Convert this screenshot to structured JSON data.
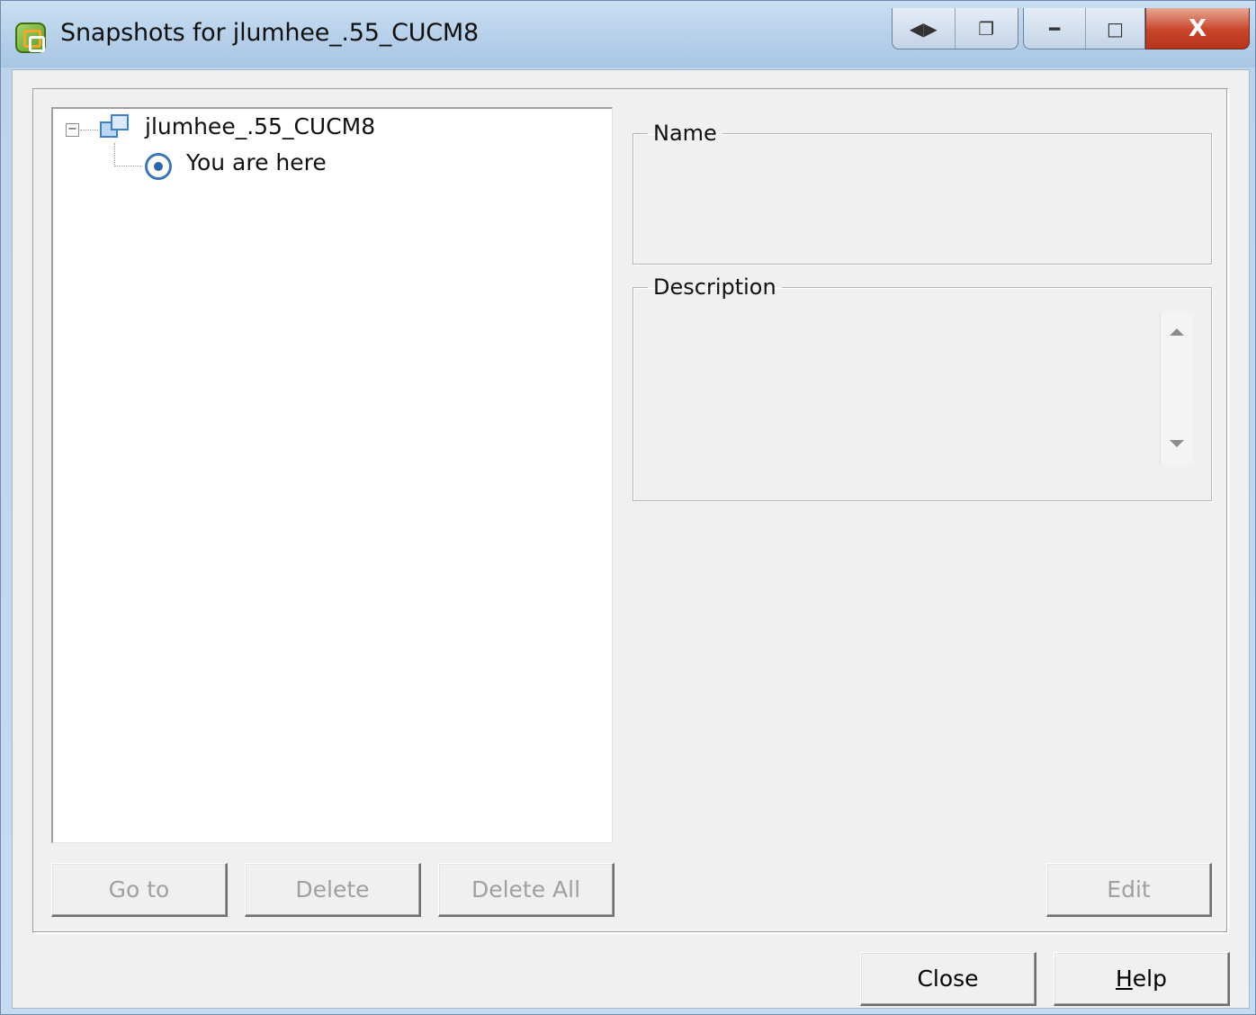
{
  "window": {
    "title": "Snapshots for jlumhee_.55_CUCM8",
    "caption_buttons": [
      "view-toggle-icon",
      "copy-icon",
      "minimize-icon",
      "maximize-icon",
      "close-icon"
    ],
    "close_glyph": "X"
  },
  "tree": {
    "root_label": "jlumhee_.55_CUCM8",
    "child_label": "You are here",
    "expander_glyph": "−"
  },
  "details": {
    "name_legend": "Name",
    "name_value": "",
    "description_legend": "Description",
    "description_value": ""
  },
  "buttons": {
    "goto": "Go to",
    "delete": "Delete",
    "delete_all": "Delete All",
    "edit": "Edit",
    "close": "Close",
    "help_prefix": "H",
    "help_rest": "elp"
  }
}
